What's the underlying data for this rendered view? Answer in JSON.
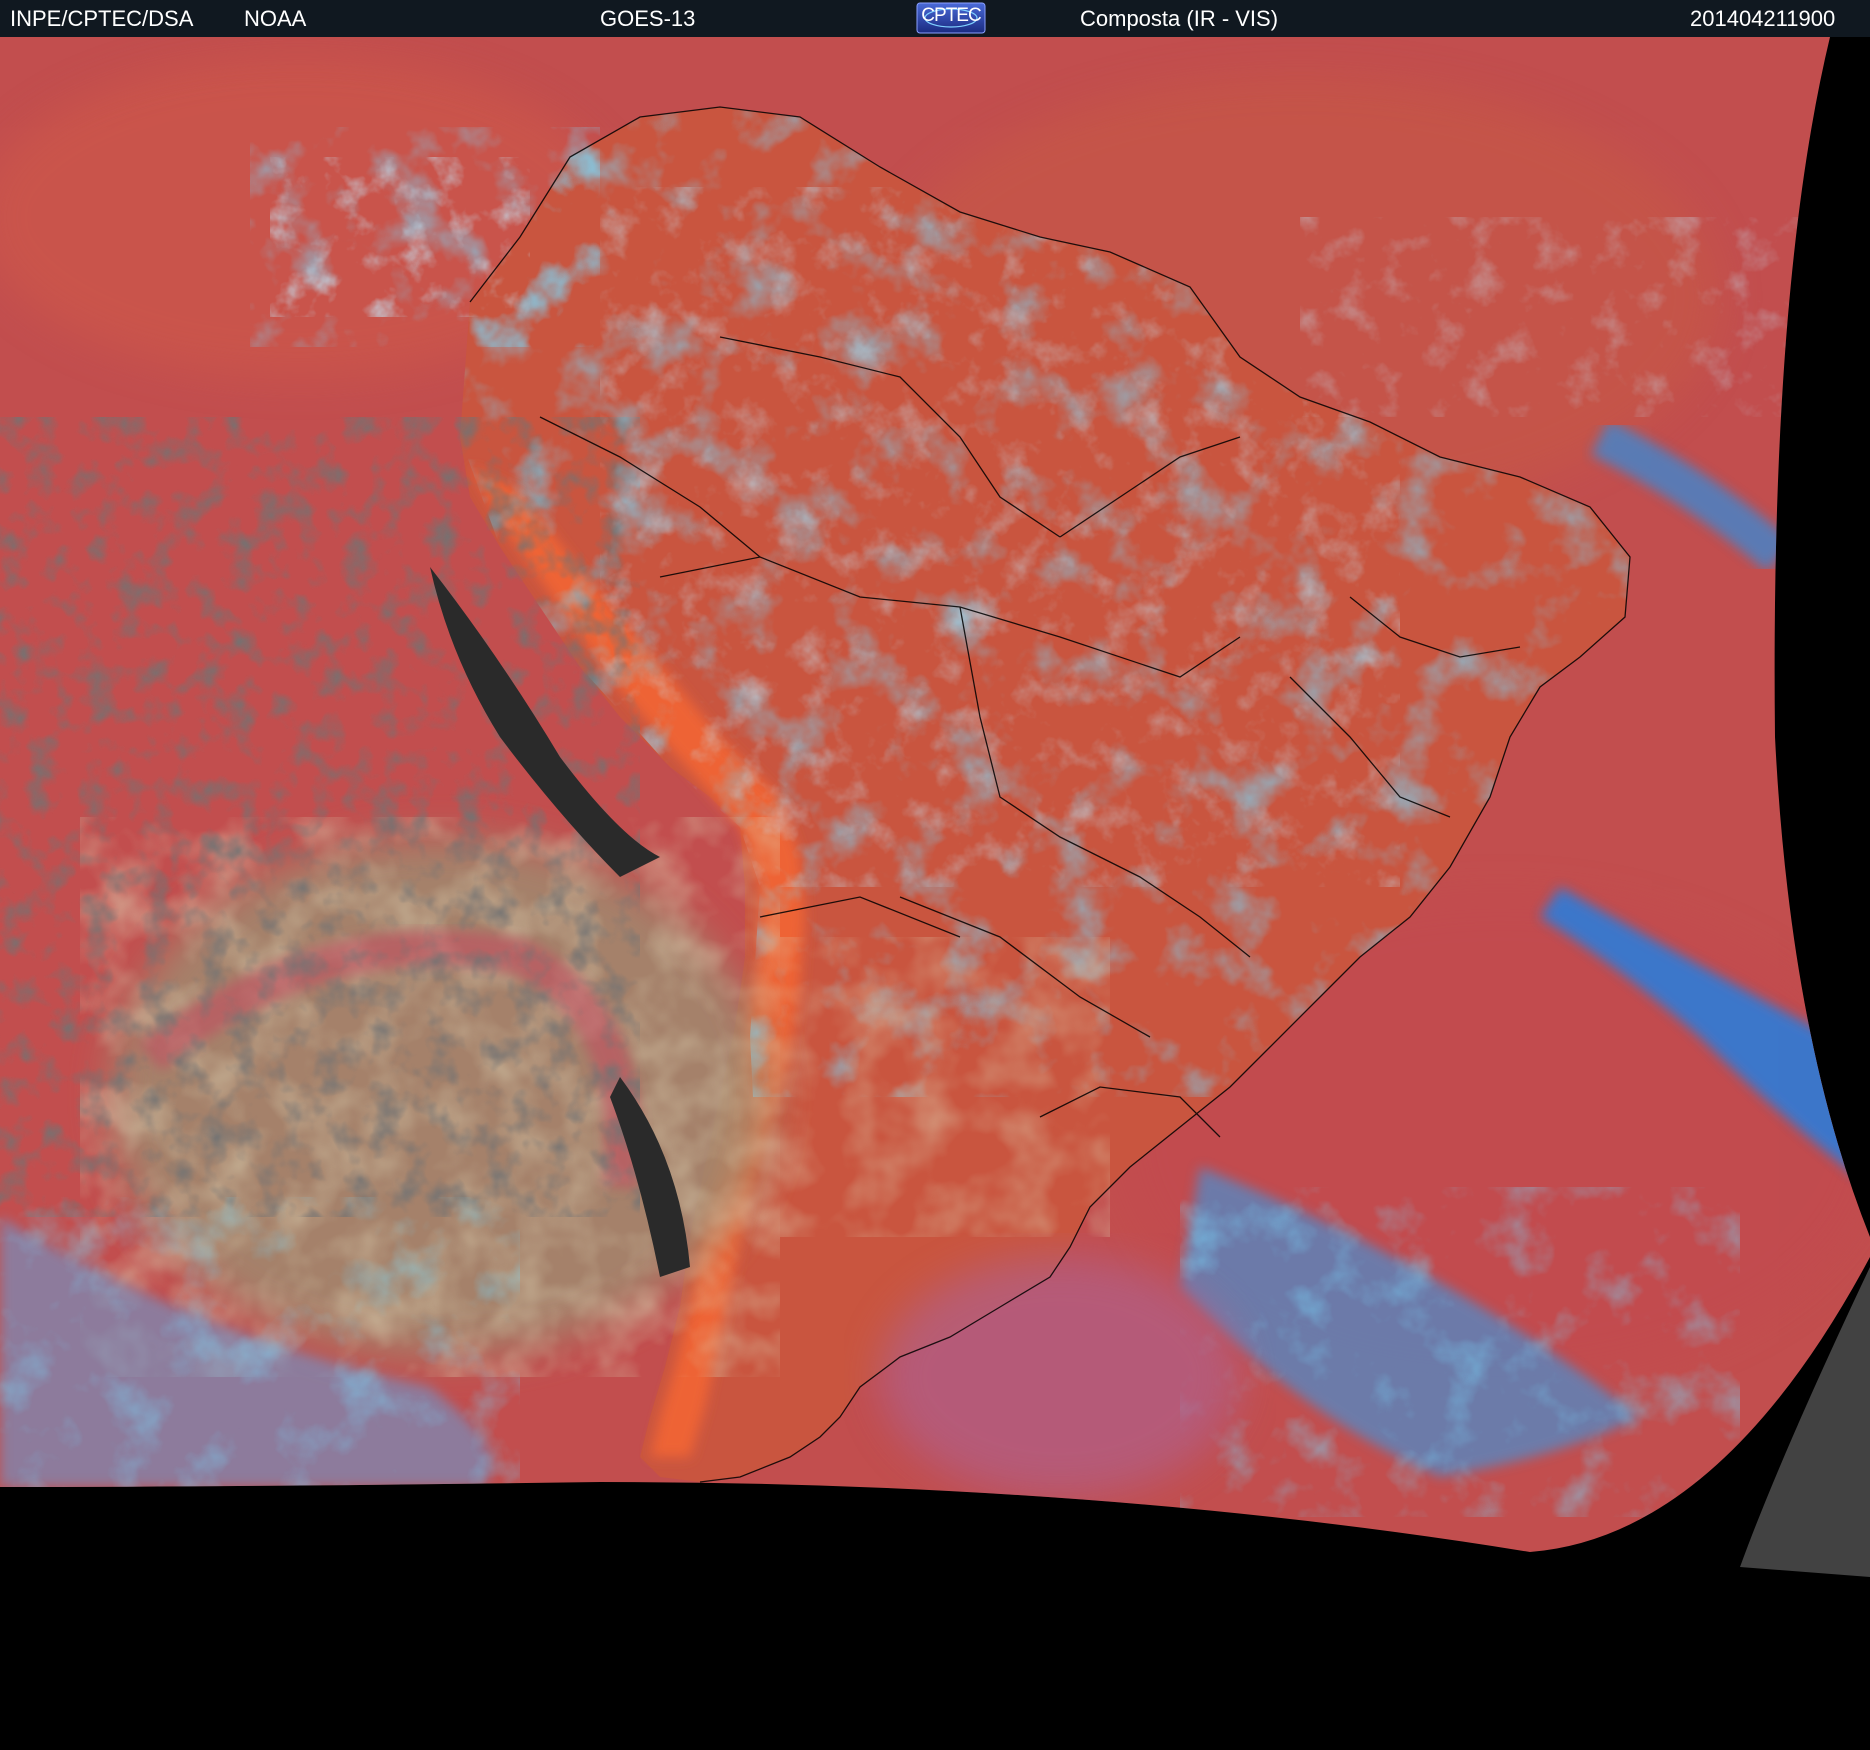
{
  "header": {
    "org": "INPE/CPTEC/DSA",
    "agency": "NOAA",
    "satellite": "GOES-13",
    "logo_text": "CPTEC",
    "product": "Composta (IR - VIS)",
    "timestamp": "201404211900"
  },
  "imagery": {
    "description_icon": "satellite-composite-image",
    "colors": {
      "clear_surface": "#c8504e",
      "warm_land": "#e8603a",
      "high_cloud": "#30b8ff",
      "deep_cloud": "#7fd8ff",
      "low_cloud": "#b0a070",
      "cold_ocean_clear": "#2a2a2a",
      "border_line": "#000000",
      "no_data": "#000000"
    }
  }
}
